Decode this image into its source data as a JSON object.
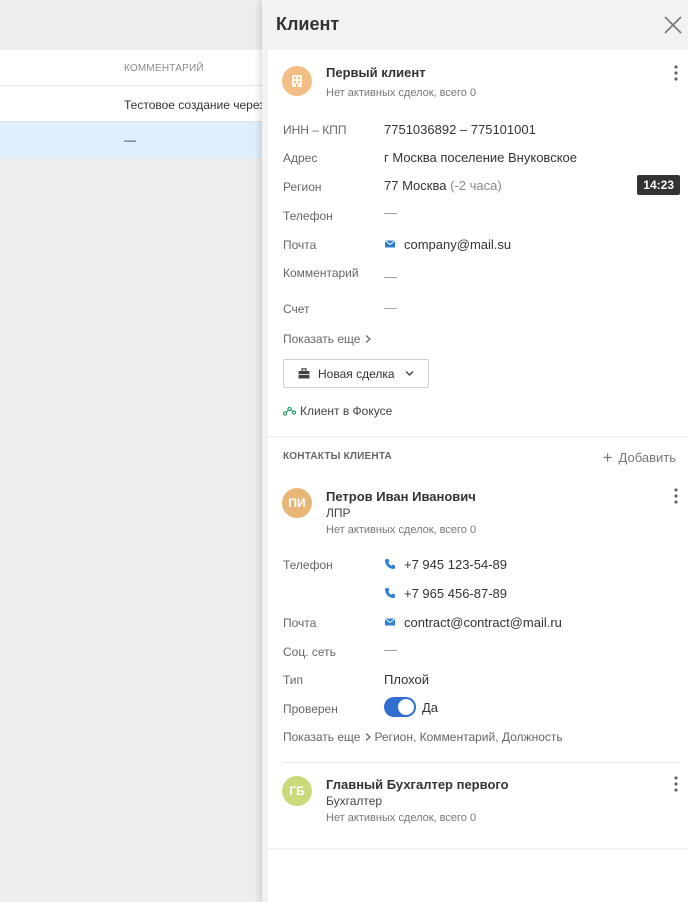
{
  "background": {
    "column_header": "КОММЕНТАРИЙ",
    "rows": [
      "Тестовое создание через",
      "—"
    ]
  },
  "panel": {
    "title": "Клиент"
  },
  "client": {
    "name": "Первый клиент",
    "deals": "Нет активных сделок, всего 0",
    "fields": {
      "inn_label": "ИНН – КПП",
      "inn_value": "7751036892 – 775101001",
      "address_label": "Адрес",
      "address_value": "г Москва поселение Внуковское",
      "region_label": "Регион",
      "region_value": "77 Москва",
      "region_tz": "(-2 часа)",
      "phone_label": "Телефон",
      "phone_value": "—",
      "email_label": "Почта",
      "email_value": "company@mail.su",
      "comment_label": "Комментарий",
      "comment_value": "—",
      "account_label": "Счет",
      "account_value": "—"
    },
    "show_more": "Показать еще",
    "time_badge": "14:23",
    "new_deal_button": "Новая сделка",
    "focus_link": "Клиент в Фокусе"
  },
  "contacts": {
    "section_title": "КОНТАКТЫ КЛИЕНТА",
    "add_label": "Добавить",
    "items": [
      {
        "initials": "ПИ",
        "name": "Петров Иван Иванович",
        "role": "ЛПР",
        "deals": "Нет активных сделок, всего 0",
        "phone_label": "Телефон",
        "phones": [
          "+7 945 123-54-89",
          "+7 965 456-87-89"
        ],
        "email_label": "Почта",
        "email_value": "contract@contract@mail.ru",
        "social_label": "Соц. сеть",
        "social_value": "—",
        "type_label": "Тип",
        "type_value": "Плохой",
        "verified_label": "Проверен",
        "verified_value": "Да",
        "show_more": "Показать еще",
        "show_more_extra": "Регион, Комментарий, Должность"
      },
      {
        "initials": "ГБ",
        "name": "Главный Бухгалтер первого",
        "role": "Бухгалтер",
        "deals": "Нет активных сделок, всего 0"
      }
    ]
  },
  "colors": {
    "accent": "#2f6fd0",
    "selected_row": "#deeefb",
    "avatar_org": "#f3bd86",
    "avatar_pi": "#e8b777",
    "avatar_gb": "#cbd97a",
    "focus_green": "#2e9e6a"
  },
  "icons": {
    "close": "close-icon",
    "more": "more-vertical-icon",
    "building": "building-icon",
    "mail": "mail-icon",
    "phone": "phone-icon",
    "briefcase": "briefcase-icon",
    "focus": "focus-link-icon",
    "plus": "plus-icon"
  }
}
